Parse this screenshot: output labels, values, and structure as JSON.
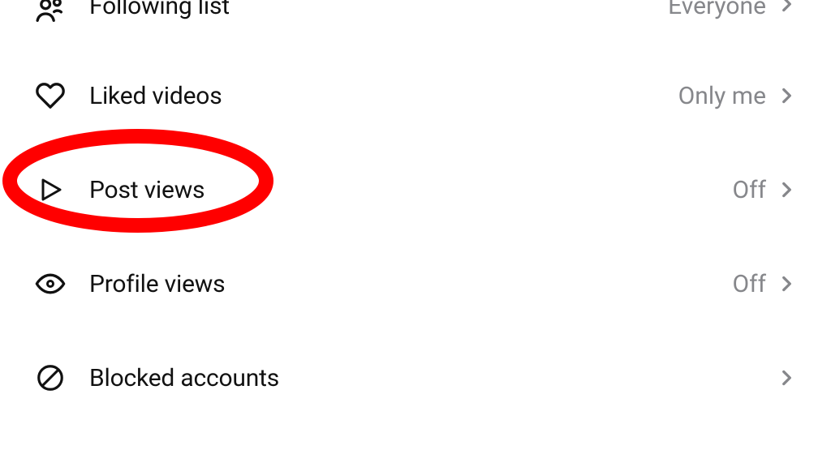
{
  "rows": [
    {
      "label": "Following list",
      "value": "Everyone"
    },
    {
      "label": "Liked videos",
      "value": "Only me"
    },
    {
      "label": "Post views",
      "value": "Off"
    },
    {
      "label": "Profile views",
      "value": "Off"
    },
    {
      "label": "Blocked accounts",
      "value": ""
    }
  ],
  "annotation": {
    "highlight_stroke": "#ff0000"
  }
}
